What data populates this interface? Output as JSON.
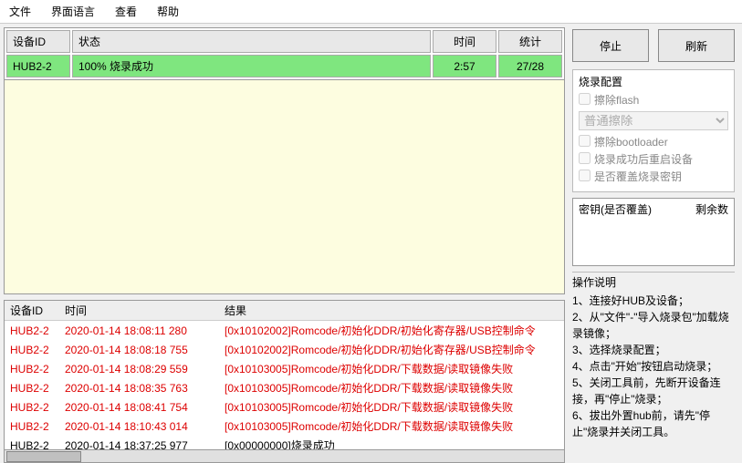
{
  "menu": [
    "文件",
    "界面语言",
    "查看",
    "帮助"
  ],
  "top_table": {
    "headers": {
      "id": "设备ID",
      "status": "状态",
      "time": "时间",
      "stat": "统计"
    },
    "rows": [
      {
        "id": "HUB2-2",
        "status": "100% 烧录成功",
        "time": "2:57",
        "stat": "27/28",
        "success": true
      }
    ]
  },
  "log_table": {
    "headers": {
      "id": "设备ID",
      "time": "时间",
      "result": "结果"
    },
    "rows": [
      {
        "id": "HUB2-2",
        "time": "2020-01-14 18:08:11 280",
        "result": "[0x10102002]Romcode/初始化DDR/初始化寄存器/USB控制命令",
        "err": true
      },
      {
        "id": "HUB2-2",
        "time": "2020-01-14 18:08:18 755",
        "result": "[0x10102002]Romcode/初始化DDR/初始化寄存器/USB控制命令",
        "err": true
      },
      {
        "id": "HUB2-2",
        "time": "2020-01-14 18:08:29 559",
        "result": "[0x10103005]Romcode/初始化DDR/下载数据/读取镜像失败",
        "err": true
      },
      {
        "id": "HUB2-2",
        "time": "2020-01-14 18:08:35 763",
        "result": "[0x10103005]Romcode/初始化DDR/下载数据/读取镜像失败",
        "err": true
      },
      {
        "id": "HUB2-2",
        "time": "2020-01-14 18:08:41 754",
        "result": "[0x10103005]Romcode/初始化DDR/下载数据/读取镜像失败",
        "err": true
      },
      {
        "id": "HUB2-2",
        "time": "2020-01-14 18:10:43 014",
        "result": "[0x10103005]Romcode/初始化DDR/下载数据/读取镜像失败",
        "err": true
      },
      {
        "id": "HUB2-2",
        "time": "2020-01-14 18:37:25 977",
        "result": "[0x00000000]烧录成功",
        "err": false
      }
    ]
  },
  "buttons": {
    "stop": "停止",
    "refresh": "刷新"
  },
  "cfg": {
    "title": "烧录配置",
    "erase_flash": "擦除flash",
    "erase_mode": "普通擦除",
    "erase_bootloader": "擦除bootloader",
    "reboot": "烧录成功后重启设备",
    "overwrite_key": "是否覆盖烧录密钥"
  },
  "key": {
    "col1": "密钥(是否覆盖)",
    "col2": "剩余数"
  },
  "ops": {
    "title": "操作说明",
    "steps": [
      "1、连接好HUB及设备；",
      "2、从\"文件\"-\"导入烧录包\"加载烧录镜像；",
      "3、选择烧录配置；",
      "4、点击\"开始\"按钮启动烧录；",
      "5、关闭工具前，先断开设备连接，再\"停止\"烧录；",
      "6、拔出外置hub前，请先\"停止\"烧录并关闭工具。"
    ]
  }
}
